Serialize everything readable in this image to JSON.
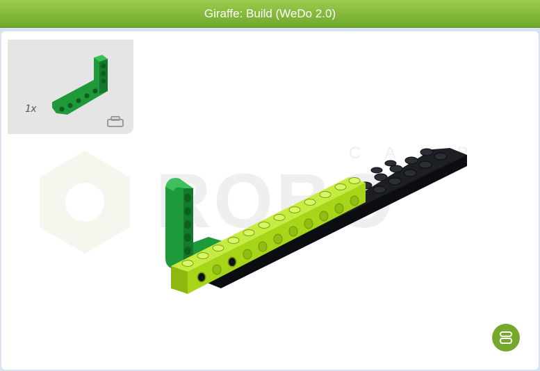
{
  "window": {
    "title": "Giraffe: Build (WeDo 2.0)"
  },
  "parts_panel": {
    "quantity": "1x",
    "part_icon": "green-l-beam-icon",
    "toggle_icon": "brick-icon"
  },
  "watermark": {
    "text_top": "CAMP",
    "text_main": "ROBO"
  },
  "actions": {
    "next_icon": "brick-icon"
  },
  "colors": {
    "title_bar": "#7fb339",
    "panel_bg": "#e5e5e5",
    "beam_green": "#1f9a3a",
    "beam_lime": "#a7d619",
    "plate_black": "#16181c",
    "fab": "#76a82d"
  }
}
